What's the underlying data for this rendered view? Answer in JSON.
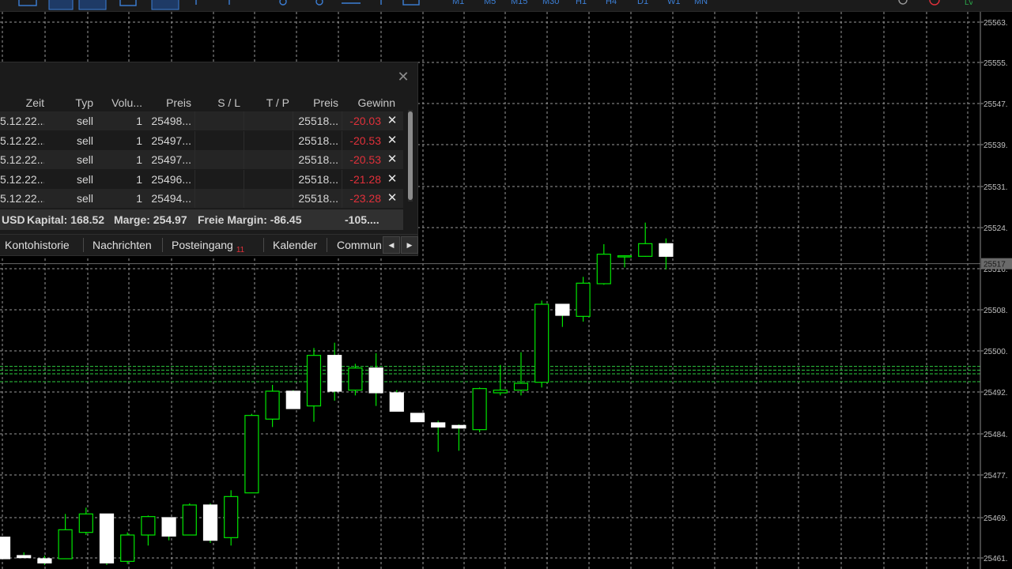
{
  "toolbar": {
    "timeframes": [
      "M1",
      "M5",
      "M15",
      "M30",
      "H1",
      "H4",
      "D1",
      "W1",
      "MN"
    ],
    "active_timeframe": "M5"
  },
  "trade_panel": {
    "columns": [
      "Zeit",
      "Typ",
      "Volu...",
      "Preis",
      "S / L",
      "T / P",
      "Preis",
      "Gewinn"
    ],
    "rows": [
      {
        "time": "5.12.22...",
        "type": "sell",
        "volume": "1",
        "open_price": "25498...",
        "sl": "",
        "tp": "",
        "price": "25518...",
        "profit": "-20.03"
      },
      {
        "time": "5.12.22...",
        "type": "sell",
        "volume": "1",
        "open_price": "25497...",
        "sl": "",
        "tp": "",
        "price": "25518...",
        "profit": "-20.53"
      },
      {
        "time": "5.12.22...",
        "type": "sell",
        "volume": "1",
        "open_price": "25497...",
        "sl": "",
        "tp": "",
        "price": "25518...",
        "profit": "-20.53"
      },
      {
        "time": "5.12.22...",
        "type": "sell",
        "volume": "1",
        "open_price": "25496...",
        "sl": "",
        "tp": "",
        "price": "25518...",
        "profit": "-21.28"
      },
      {
        "time": "5.12.22...",
        "type": "sell",
        "volume": "1",
        "open_price": "25494...",
        "sl": "",
        "tp": "",
        "price": "25518...",
        "profit": "-23.28"
      }
    ],
    "summary": {
      "currency": "USD",
      "capital": "Kapital: 168.52",
      "margin": "Marge: 254.97",
      "free_margin": "Freie Margin: -86.45",
      "total": "-105...."
    },
    "tabs": [
      {
        "label": "Kontohistorie"
      },
      {
        "label": "Nachrichten"
      },
      {
        "label": "Posteingang",
        "badge": "11"
      },
      {
        "label": "Kalender"
      },
      {
        "label": "Commun"
      }
    ]
  },
  "price_axis": {
    "labels": [
      "25563.",
      "25555.",
      "25547.",
      "25539.",
      "25531.",
      "25524.",
      "25516.",
      "25508.",
      "25500.",
      "25492.",
      "25484.",
      "25477.",
      "25469.",
      "25461."
    ],
    "current_price": "25517"
  },
  "colors": {
    "background": "#000000",
    "grid": "#9a9a9a",
    "bull_body": "#000000",
    "bull_stroke": "#00e600",
    "bear_body": "#ffffff",
    "wick": "#00e600",
    "loss_text": "#e2303a",
    "accent": "#3c7fd6"
  },
  "chart_data": {
    "type": "candlestick",
    "title": "",
    "ylim": [
      25459,
      25568
    ],
    "grid": true,
    "price_levels_dashed": [
      25497.5,
      25496.8,
      25496.1,
      25494.6
    ],
    "current_price_line": 25517,
    "candles": [
      {
        "o": 25465.1,
        "h": 25465.1,
        "l": 25461.0,
        "c": 25461.0
      },
      {
        "o": 25461.6,
        "h": 25462.2,
        "l": 25461.2,
        "c": 25461.2
      },
      {
        "o": 25461.0,
        "h": 25461.6,
        "l": 25459.8,
        "c": 25460.2
      },
      {
        "o": 25461.0,
        "h": 25469.5,
        "l": 25461.0,
        "c": 25466.5
      },
      {
        "o": 25466.0,
        "h": 25470.7,
        "l": 25465.5,
        "c": 25469.5
      },
      {
        "o": 25469.5,
        "h": 25469.5,
        "l": 25459.8,
        "c": 25460.2
      },
      {
        "o": 25460.5,
        "h": 25466.0,
        "l": 25460.0,
        "c": 25465.5
      },
      {
        "o": 25465.5,
        "h": 25469.2,
        "l": 25463.5,
        "c": 25469.0
      },
      {
        "o": 25468.8,
        "h": 25468.8,
        "l": 25464.5,
        "c": 25465.3
      },
      {
        "o": 25465.5,
        "h": 25471.5,
        "l": 25465.5,
        "c": 25471.2
      },
      {
        "o": 25471.2,
        "h": 25471.5,
        "l": 25464.0,
        "c": 25464.5
      },
      {
        "o": 25465.0,
        "h": 25474.0,
        "l": 25463.5,
        "c": 25472.8
      },
      {
        "o": 25473.5,
        "h": 25488.5,
        "l": 25473.5,
        "c": 25488.2
      },
      {
        "o": 25487.5,
        "h": 25494.0,
        "l": 25486.0,
        "c": 25492.8
      },
      {
        "o": 25492.8,
        "h": 25493.0,
        "l": 25489.5,
        "c": 25489.5
      },
      {
        "o": 25490.0,
        "h": 25501.0,
        "l": 25487.0,
        "c": 25499.6
      },
      {
        "o": 25499.6,
        "h": 25502.0,
        "l": 25491.0,
        "c": 25492.8
      },
      {
        "o": 25493.0,
        "h": 25498.0,
        "l": 25492.0,
        "c": 25497.2
      },
      {
        "o": 25497.2,
        "h": 25500.0,
        "l": 25490.0,
        "c": 25492.5
      },
      {
        "o": 25492.5,
        "h": 25493.0,
        "l": 25489.0,
        "c": 25489.0
      },
      {
        "o": 25488.6,
        "h": 25488.6,
        "l": 25487.0,
        "c": 25487.0
      },
      {
        "o": 25486.8,
        "h": 25487.2,
        "l": 25481.3,
        "c": 25486.0
      },
      {
        "o": 25486.3,
        "h": 25486.5,
        "l": 25481.5,
        "c": 25485.8
      },
      {
        "o": 25485.5,
        "h": 25493.5,
        "l": 25485.0,
        "c": 25493.3
      },
      {
        "o": 25492.5,
        "h": 25497.8,
        "l": 25492.0,
        "c": 25493.0
      },
      {
        "o": 25493.0,
        "h": 25500.2,
        "l": 25492.0,
        "c": 25494.3
      },
      {
        "o": 25494.5,
        "h": 25510.0,
        "l": 25493.5,
        "c": 25509.3
      },
      {
        "o": 25509.3,
        "h": 25509.3,
        "l": 25505.0,
        "c": 25507.2
      },
      {
        "o": 25507.0,
        "h": 25514.5,
        "l": 25506.0,
        "c": 25513.3
      },
      {
        "o": 25513.2,
        "h": 25520.7,
        "l": 25513.0,
        "c": 25518.8
      },
      {
        "o": 25518.3,
        "h": 25518.6,
        "l": 25516.3,
        "c": 25518.5
      },
      {
        "o": 25518.4,
        "h": 25524.8,
        "l": 25518.3,
        "c": 25520.8
      },
      {
        "o": 25520.8,
        "h": 25521.8,
        "l": 25515.9,
        "c": 25518.4
      }
    ]
  }
}
